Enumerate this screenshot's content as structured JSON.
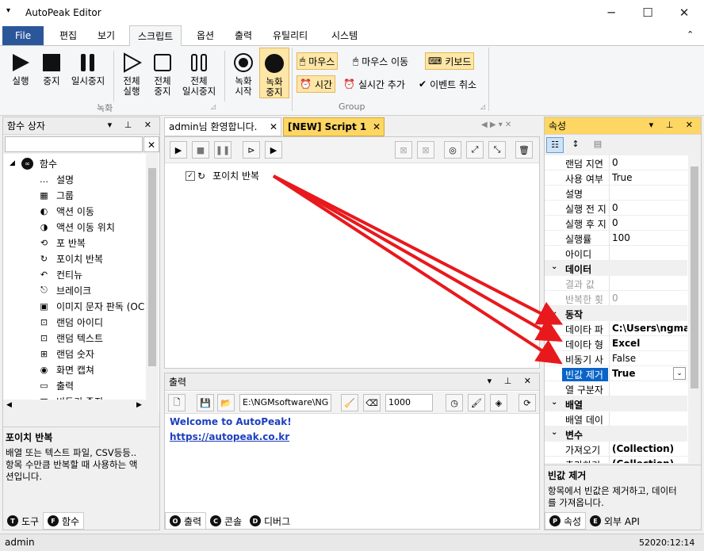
{
  "window": {
    "title": "AutoPeak Editor",
    "minimize": "─",
    "maximize": "☐",
    "close": "✕"
  },
  "menu": {
    "file": "File",
    "items": [
      "편집",
      "보기",
      "스크립트",
      "옵션",
      "출력",
      "유틸리티",
      "시스템"
    ]
  },
  "ribbon": {
    "record_group": {
      "label": "녹화",
      "buttons": [
        "실행",
        "중지",
        "일시중지",
        "전체\n실행",
        "전체\n중지",
        "전체\n일시중지",
        "녹화\n시작",
        "녹화\n중지"
      ]
    },
    "group": {
      "label": "Group",
      "mouse": "마우스",
      "mouse_move": "마우스 이동",
      "keyboard": "키보드",
      "time": "시간",
      "realtime_add": "실시간 추가",
      "event_cancel": "이벤트 취소"
    }
  },
  "left_panel": {
    "title": "함수 상자",
    "root": "함수",
    "items": [
      "설명",
      "그룹",
      "액션 이동",
      "액션 이동 위치",
      "포 반복",
      "포이치 반복",
      "컨티뉴",
      "브레이크",
      "이미지 문자 판독 (OC",
      "랜덤 아이디",
      "랜덤 텍스트",
      "랜덤 숫자",
      "화면 캡쳐",
      "출력",
      "비동기 중지"
    ],
    "desc_title": "포이치 반복",
    "desc_text": "배열 또는 텍스트 파일, CSV등등..\n항목 수만큼 반복할 때 사용하는 액\n션입니다.",
    "tabs": [
      "도구",
      "함수"
    ]
  },
  "editor": {
    "tabs": [
      "admin님 환영합니다.",
      "[NEW] Script 1"
    ],
    "tree_item": "포이치 반복"
  },
  "output": {
    "title": "출력",
    "path": "E:\\NGMsoftware\\NG",
    "count": "1000",
    "lines": [
      "Welcome to AutoPeak!",
      "https://autopeak.co.kr"
    ],
    "tabs": [
      "출력",
      "콘솔",
      "디버그"
    ]
  },
  "properties": {
    "title": "속성",
    "rows_top": [
      {
        "name": "랜덤 지연",
        "value": "0"
      },
      {
        "name": "사용 여부",
        "value": "True"
      },
      {
        "name": "설명",
        "value": ""
      },
      {
        "name": "실행 전 지",
        "value": "0"
      },
      {
        "name": "실행 후 지",
        "value": "0"
      },
      {
        "name": "실행률",
        "value": "100"
      },
      {
        "name": "아이디",
        "value": ""
      }
    ],
    "cat_data": "데이터",
    "rows_data": [
      {
        "name": "결과 값",
        "value": ""
      },
      {
        "name": "반복한 횟",
        "value": "0"
      }
    ],
    "cat_action": "동작",
    "rows_action": [
      {
        "name": "데이타 파",
        "value": "C:\\Users\\ngma"
      },
      {
        "name": "데이타 형",
        "value": "Excel"
      },
      {
        "name": "비동기 사",
        "value": "False"
      },
      {
        "name": "빈값 제거",
        "value": "True"
      },
      {
        "name": "열 구분자",
        "value": ""
      }
    ],
    "cat_array": "배열",
    "rows_array": [
      {
        "name": "배열 데이",
        "value": ""
      }
    ],
    "cat_var": "변수",
    "rows_var": [
      {
        "name": "가져오기",
        "value": "(Collection)"
      },
      {
        "name": "추가하기",
        "value": "(Collection)"
      }
    ],
    "desc_title": "빈값 제거",
    "desc_text": "항목에서 빈값은 제거하고, 데이터\n를 가져옵니다.",
    "tabs": [
      "속성",
      "외부 API"
    ]
  },
  "status": {
    "left": "admin",
    "right": "52020:12:14"
  },
  "colors": {
    "accent": "#2b579a",
    "highlight": "#fdd663",
    "arrow": "#e8191c"
  }
}
